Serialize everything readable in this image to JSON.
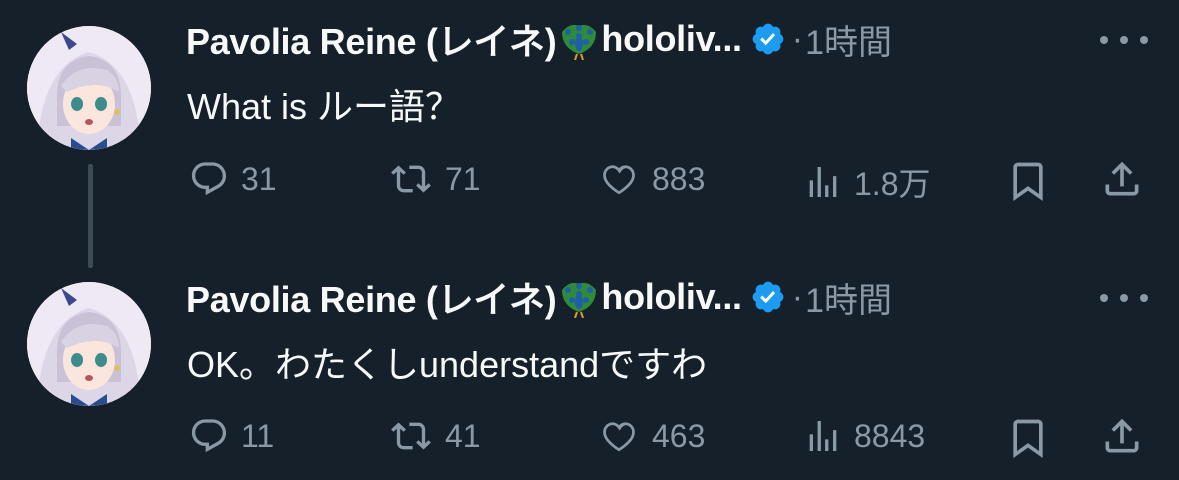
{
  "tweets": [
    {
      "author": "Pavolia Reine (レイネ)",
      "handle_suffix": "hololiv...",
      "separator": "·",
      "time": "1時間",
      "text": "What is ルー語？",
      "replies": "31",
      "retweets": "71",
      "likes": "883",
      "views": "1.8万"
    },
    {
      "author": "Pavolia Reine (レイネ)",
      "handle_suffix": "hololiv...",
      "separator": "·",
      "time": "1時間",
      "text": "OK。わたくしunderstandですわ",
      "replies": "11",
      "retweets": "41",
      "likes": "463",
      "views": "8843"
    }
  ],
  "colors": {
    "background": "#15202b",
    "text": "#f7f9f9",
    "muted": "#8b98a5",
    "verified": "#1d9bf0",
    "thread_line": "#3e4a56"
  },
  "icons": [
    "peacock-emoji-icon",
    "verified-badge-icon",
    "more-icon",
    "reply-icon",
    "retweet-icon",
    "like-icon",
    "views-icon",
    "bookmark-icon",
    "share-icon"
  ]
}
